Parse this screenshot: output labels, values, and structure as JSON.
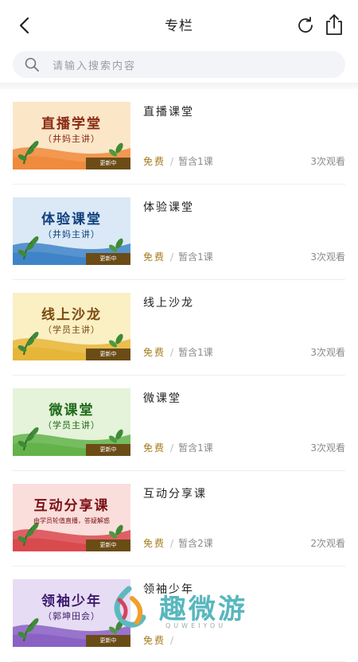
{
  "header": {
    "title": "专栏",
    "back_icon": "chevron-left-icon",
    "refresh_icon": "refresh-icon",
    "share_icon": "share-icon"
  },
  "search": {
    "placeholder": "请输入搜索内容"
  },
  "courses": [
    {
      "thumb_title": "直播学堂",
      "thumb_subtitle": "（井妈主讲）",
      "thumb_badge": "更新中",
      "title": "直播课堂",
      "price": "免费",
      "lessons": "暂含1课",
      "views": "3次观看",
      "colors": {
        "top": "#fbe6c8",
        "bottom": "#f08a3c",
        "text": "#8a2a12"
      }
    },
    {
      "thumb_title": "体验课堂",
      "thumb_subtitle": "（井妈主讲）",
      "thumb_badge": "更新中",
      "title": "体验课堂",
      "price": "免费",
      "lessons": "暂含1课",
      "views": "3次观看",
      "colors": {
        "top": "#dbe9f7",
        "bottom": "#3f84c8",
        "text": "#12407e"
      }
    },
    {
      "thumb_title": "线上沙龙",
      "thumb_subtitle": "（学员主讲）",
      "thumb_badge": "更新中",
      "title": "线上沙龙",
      "price": "免费",
      "lessons": "暂含1课",
      "views": "3次观看",
      "colors": {
        "top": "#fbefc4",
        "bottom": "#e6b63a",
        "text": "#7a4a10"
      }
    },
    {
      "thumb_title": "微课堂",
      "thumb_subtitle": "（学员主讲）",
      "thumb_badge": "更新中",
      "title": "微课堂",
      "price": "免费",
      "lessons": "暂含1课",
      "views": "3次观看",
      "colors": {
        "top": "#e4f3d9",
        "bottom": "#64b24a",
        "text": "#1f6a1a"
      }
    },
    {
      "thumb_title": "互动分享课",
      "thumb_subtitle": "由学员轮值直播，答疑解惑",
      "thumb_badge": "更新中",
      "title": "互动分享课",
      "price": "免费",
      "lessons": "暂含2课",
      "views": "2次观看",
      "colors": {
        "top": "#fadedb",
        "bottom": "#d94a4f",
        "text": "#7a1015"
      }
    },
    {
      "thumb_title": "领袖少年",
      "thumb_subtitle": "（郭坤田会）",
      "thumb_badge": "更新中",
      "title": "领袖少年",
      "price": "免费",
      "lessons": "",
      "views": "",
      "colors": {
        "top": "#e6dcf3",
        "bottom": "#8a62c4",
        "text": "#3e1a6e"
      }
    }
  ],
  "watermark": {
    "text": "趣微游",
    "sub": "QUWEIYOU"
  }
}
